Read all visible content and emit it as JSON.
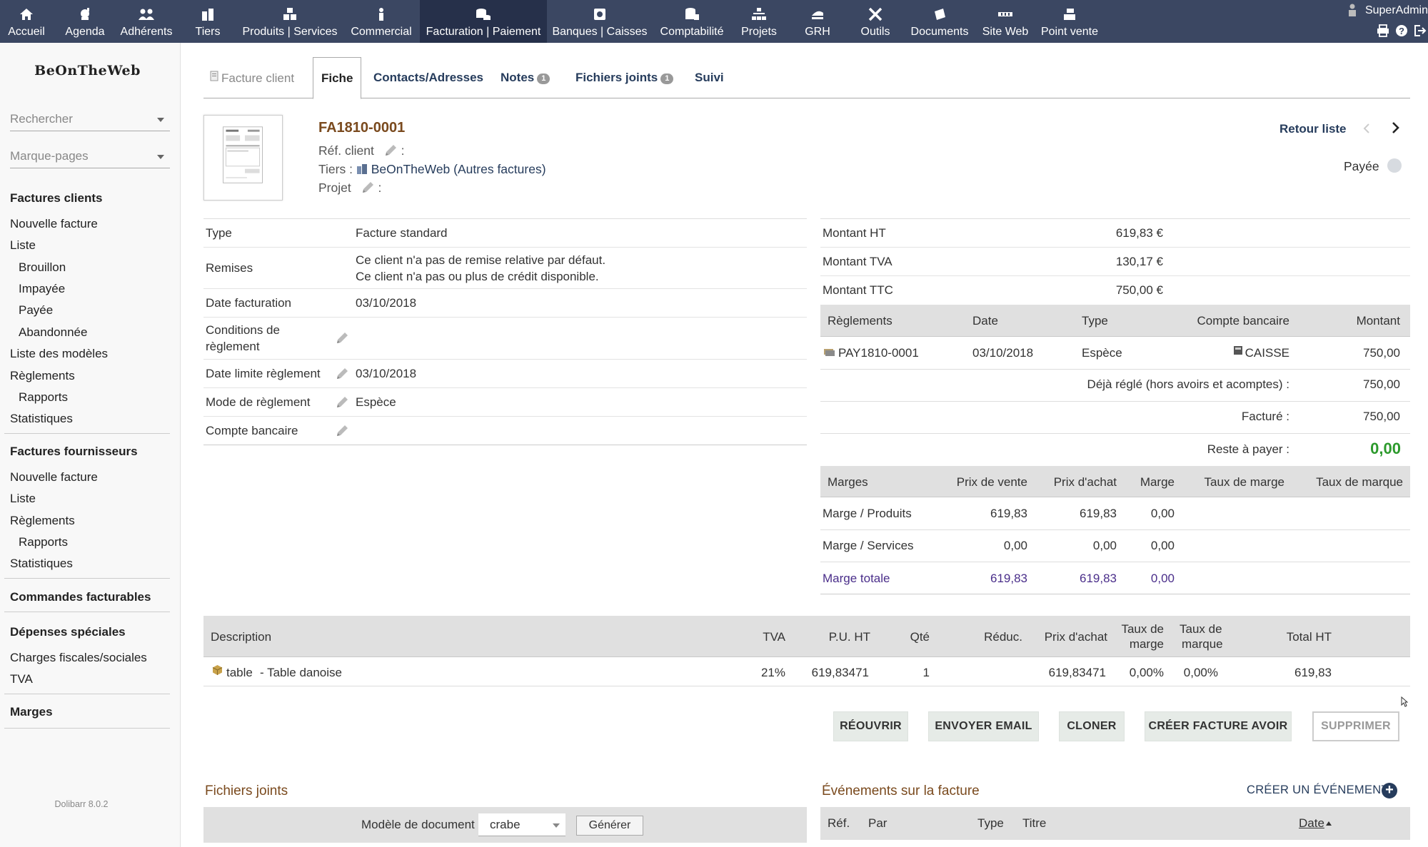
{
  "topmenu": [
    {
      "label": "Accueil",
      "icon": "home-icon"
    },
    {
      "label": "Agenda",
      "icon": "agenda-icon"
    },
    {
      "label": "Adhérents",
      "icon": "members-icon"
    },
    {
      "label": "Tiers",
      "icon": "company-icon"
    },
    {
      "label": "Produits | Services",
      "icon": "products-icon"
    },
    {
      "label": "Commercial",
      "icon": "commercial-icon"
    },
    {
      "label": "Facturation | Paiement",
      "icon": "billing-icon"
    },
    {
      "label": "Banques | Caisses",
      "icon": "bank-icon"
    },
    {
      "label": "Comptabilité",
      "icon": "accounting-icon"
    },
    {
      "label": "Projets",
      "icon": "projects-icon"
    },
    {
      "label": "GRH",
      "icon": "hrm-icon"
    },
    {
      "label": "Outils",
      "icon": "tools-icon"
    },
    {
      "label": "Documents",
      "icon": "documents-icon"
    },
    {
      "label": "Site Web",
      "icon": "website-icon"
    },
    {
      "label": "Point vente",
      "icon": "pos-icon"
    }
  ],
  "user": {
    "name": "SuperAdmin"
  },
  "sidebar": {
    "logo": "BeOnTheWeb",
    "search_placeholder": "Rechercher",
    "bookmarks_placeholder": "Marque-pages",
    "customer_invoices": {
      "title": "Factures clients",
      "items": [
        "Nouvelle facture",
        "Liste",
        "Brouillon",
        "Impayée",
        "Payée",
        "Abandonnée",
        "Liste des modèles",
        "Règlements",
        "Rapports",
        "Statistiques"
      ]
    },
    "supplier_invoices": {
      "title": "Factures fournisseurs",
      "items": [
        "Nouvelle facture",
        "Liste",
        "Règlements",
        "Rapports",
        "Statistiques"
      ]
    },
    "billable_orders": "Commandes facturables",
    "special_expenses": {
      "title": "Dépenses spéciales",
      "items": [
        "Charges fiscales/sociales",
        "TVA"
      ]
    },
    "margins": "Marges",
    "version": "Dolibarr 8.0.2"
  },
  "tabs": {
    "invoice": "Facture client",
    "card": "Fiche",
    "contacts": "Contacts/Adresses",
    "notes": "Notes",
    "notes_count": "1",
    "files": "Fichiers joints",
    "files_count": "1",
    "followup": "Suivi"
  },
  "header": {
    "ref": "FA1810-0001",
    "ref_client_label": "Réf. client",
    "tiers_label": "Tiers :",
    "tiers_name": "BeOnTheWeb",
    "tiers_other": "(Autres factures)",
    "project_label": "Projet",
    "colon": ":",
    "back_list": "Retour liste",
    "status": "Payée"
  },
  "info": {
    "type_label": "Type",
    "type_value": "Facture standard",
    "discounts_label": "Remises",
    "discounts_line1": "Ce client n'a pas de remise relative par défaut.",
    "discounts_line2": "Ce client n'a pas ou plus de crédit disponible.",
    "date_label": "Date facturation",
    "date_value": "03/10/2018",
    "conditions_label_1": "Conditions de",
    "conditions_label_2": "règlement",
    "due_label": "Date limite règlement",
    "due_value": "03/10/2018",
    "mode_label": "Mode de règlement",
    "mode_value": "Espèce",
    "bank_label": "Compte bancaire"
  },
  "amounts": {
    "ht_label": "Montant HT",
    "ht_value": "619,83 €",
    "tva_label": "Montant TVA",
    "tva_value": "130,17 €",
    "ttc_label": "Montant TTC",
    "ttc_value": "750,00 €"
  },
  "payments": {
    "headers": {
      "payments": "Règlements",
      "date": "Date",
      "type": "Type",
      "account": "Compte bancaire",
      "amount": "Montant"
    },
    "rows": [
      {
        "ref": "PAY1810-0001",
        "date": "03/10/2018",
        "type": "Espèce",
        "account": "CAISSE",
        "amount": "750,00"
      }
    ],
    "already_paid_label": "Déjà réglé (hors avoirs et acomptes) :",
    "already_paid_value": "750,00",
    "billed_label": "Facturé :",
    "billed_value": "750,00",
    "remaining_label": "Reste à payer :",
    "remaining_value": "0,00"
  },
  "margins": {
    "headers": {
      "margins": "Marges",
      "sale": "Prix de vente",
      "buy": "Prix d'achat",
      "margin": "Marge",
      "margin_rate": "Taux de marge",
      "mark_rate": "Taux de marque"
    },
    "rows": [
      {
        "label": "Marge / Produits",
        "sale": "619,83",
        "buy": "619,83",
        "margin": "0,00"
      },
      {
        "label": "Marge / Services",
        "sale": "0,00",
        "buy": "0,00",
        "margin": "0,00"
      }
    ],
    "total": {
      "label": "Marge totale",
      "sale": "619,83",
      "buy": "619,83",
      "margin": "0,00"
    }
  },
  "lines": {
    "headers": {
      "desc": "Description",
      "tva": "TVA",
      "pu": "P.U. HT",
      "qty": "Qté",
      "disc": "Réduc.",
      "buy": "Prix d'achat",
      "mrate_1": "Taux de",
      "mrate_2": "marge",
      "krate_1": "Taux de",
      "krate_2": "marque",
      "total": "Total HT"
    },
    "rows": [
      {
        "ref": "table",
        "label": "- Table danoise",
        "tva": "21%",
        "pu": "619,83471",
        "qty": "1",
        "buy": "619,83471",
        "mrate": "0,00%",
        "krate": "0,00%",
        "total": "619,83"
      }
    ]
  },
  "actions": {
    "reopen": "RÉOUVRIR",
    "email": "ENVOYER EMAIL",
    "clone": "CLONER",
    "credit": "CRÉER FACTURE AVOIR",
    "delete": "SUPPRIMER"
  },
  "files": {
    "title": "Fichiers joints",
    "model_label": "Modèle de document",
    "model_value": "crabe",
    "generate": "Générer"
  },
  "events": {
    "title": "Événements sur la facture",
    "create": "CRÉER UN ÉVÉNEMENT",
    "headers": {
      "ref": "Réf.",
      "by": "Par",
      "type": "Type",
      "title": "Titre",
      "date": "Date"
    }
  },
  "colors": {
    "topbar": "#3b4762",
    "topbar_active": "#26304a",
    "link": "#263c5c",
    "ref": "#7a4a1e",
    "remaining": "#2c9a2c",
    "margin_total": "#4a2e8a"
  }
}
